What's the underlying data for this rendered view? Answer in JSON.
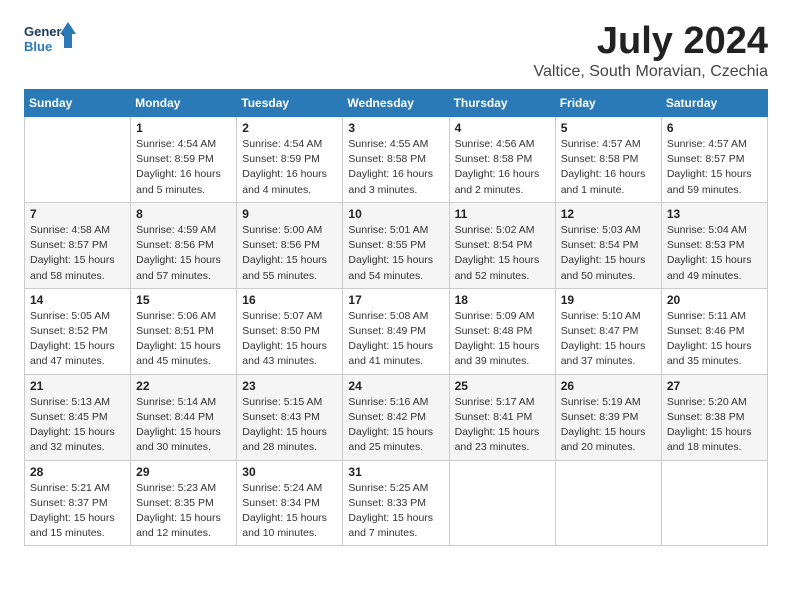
{
  "header": {
    "logo_general": "General",
    "logo_blue": "Blue",
    "month_title": "July 2024",
    "location": "Valtice, South Moravian, Czechia"
  },
  "weekdays": [
    "Sunday",
    "Monday",
    "Tuesday",
    "Wednesday",
    "Thursday",
    "Friday",
    "Saturday"
  ],
  "weeks": [
    [
      {
        "day": "",
        "info": ""
      },
      {
        "day": "1",
        "info": "Sunrise: 4:54 AM\nSunset: 8:59 PM\nDaylight: 16 hours\nand 5 minutes."
      },
      {
        "day": "2",
        "info": "Sunrise: 4:54 AM\nSunset: 8:59 PM\nDaylight: 16 hours\nand 4 minutes."
      },
      {
        "day": "3",
        "info": "Sunrise: 4:55 AM\nSunset: 8:58 PM\nDaylight: 16 hours\nand 3 minutes."
      },
      {
        "day": "4",
        "info": "Sunrise: 4:56 AM\nSunset: 8:58 PM\nDaylight: 16 hours\nand 2 minutes."
      },
      {
        "day": "5",
        "info": "Sunrise: 4:57 AM\nSunset: 8:58 PM\nDaylight: 16 hours\nand 1 minute."
      },
      {
        "day": "6",
        "info": "Sunrise: 4:57 AM\nSunset: 8:57 PM\nDaylight: 15 hours\nand 59 minutes."
      }
    ],
    [
      {
        "day": "7",
        "info": "Sunrise: 4:58 AM\nSunset: 8:57 PM\nDaylight: 15 hours\nand 58 minutes."
      },
      {
        "day": "8",
        "info": "Sunrise: 4:59 AM\nSunset: 8:56 PM\nDaylight: 15 hours\nand 57 minutes."
      },
      {
        "day": "9",
        "info": "Sunrise: 5:00 AM\nSunset: 8:56 PM\nDaylight: 15 hours\nand 55 minutes."
      },
      {
        "day": "10",
        "info": "Sunrise: 5:01 AM\nSunset: 8:55 PM\nDaylight: 15 hours\nand 54 minutes."
      },
      {
        "day": "11",
        "info": "Sunrise: 5:02 AM\nSunset: 8:54 PM\nDaylight: 15 hours\nand 52 minutes."
      },
      {
        "day": "12",
        "info": "Sunrise: 5:03 AM\nSunset: 8:54 PM\nDaylight: 15 hours\nand 50 minutes."
      },
      {
        "day": "13",
        "info": "Sunrise: 5:04 AM\nSunset: 8:53 PM\nDaylight: 15 hours\nand 49 minutes."
      }
    ],
    [
      {
        "day": "14",
        "info": "Sunrise: 5:05 AM\nSunset: 8:52 PM\nDaylight: 15 hours\nand 47 minutes."
      },
      {
        "day": "15",
        "info": "Sunrise: 5:06 AM\nSunset: 8:51 PM\nDaylight: 15 hours\nand 45 minutes."
      },
      {
        "day": "16",
        "info": "Sunrise: 5:07 AM\nSunset: 8:50 PM\nDaylight: 15 hours\nand 43 minutes."
      },
      {
        "day": "17",
        "info": "Sunrise: 5:08 AM\nSunset: 8:49 PM\nDaylight: 15 hours\nand 41 minutes."
      },
      {
        "day": "18",
        "info": "Sunrise: 5:09 AM\nSunset: 8:48 PM\nDaylight: 15 hours\nand 39 minutes."
      },
      {
        "day": "19",
        "info": "Sunrise: 5:10 AM\nSunset: 8:47 PM\nDaylight: 15 hours\nand 37 minutes."
      },
      {
        "day": "20",
        "info": "Sunrise: 5:11 AM\nSunset: 8:46 PM\nDaylight: 15 hours\nand 35 minutes."
      }
    ],
    [
      {
        "day": "21",
        "info": "Sunrise: 5:13 AM\nSunset: 8:45 PM\nDaylight: 15 hours\nand 32 minutes."
      },
      {
        "day": "22",
        "info": "Sunrise: 5:14 AM\nSunset: 8:44 PM\nDaylight: 15 hours\nand 30 minutes."
      },
      {
        "day": "23",
        "info": "Sunrise: 5:15 AM\nSunset: 8:43 PM\nDaylight: 15 hours\nand 28 minutes."
      },
      {
        "day": "24",
        "info": "Sunrise: 5:16 AM\nSunset: 8:42 PM\nDaylight: 15 hours\nand 25 minutes."
      },
      {
        "day": "25",
        "info": "Sunrise: 5:17 AM\nSunset: 8:41 PM\nDaylight: 15 hours\nand 23 minutes."
      },
      {
        "day": "26",
        "info": "Sunrise: 5:19 AM\nSunset: 8:39 PM\nDaylight: 15 hours\nand 20 minutes."
      },
      {
        "day": "27",
        "info": "Sunrise: 5:20 AM\nSunset: 8:38 PM\nDaylight: 15 hours\nand 18 minutes."
      }
    ],
    [
      {
        "day": "28",
        "info": "Sunrise: 5:21 AM\nSunset: 8:37 PM\nDaylight: 15 hours\nand 15 minutes."
      },
      {
        "day": "29",
        "info": "Sunrise: 5:23 AM\nSunset: 8:35 PM\nDaylight: 15 hours\nand 12 minutes."
      },
      {
        "day": "30",
        "info": "Sunrise: 5:24 AM\nSunset: 8:34 PM\nDaylight: 15 hours\nand 10 minutes."
      },
      {
        "day": "31",
        "info": "Sunrise: 5:25 AM\nSunset: 8:33 PM\nDaylight: 15 hours\nand 7 minutes."
      },
      {
        "day": "",
        "info": ""
      },
      {
        "day": "",
        "info": ""
      },
      {
        "day": "",
        "info": ""
      }
    ]
  ]
}
